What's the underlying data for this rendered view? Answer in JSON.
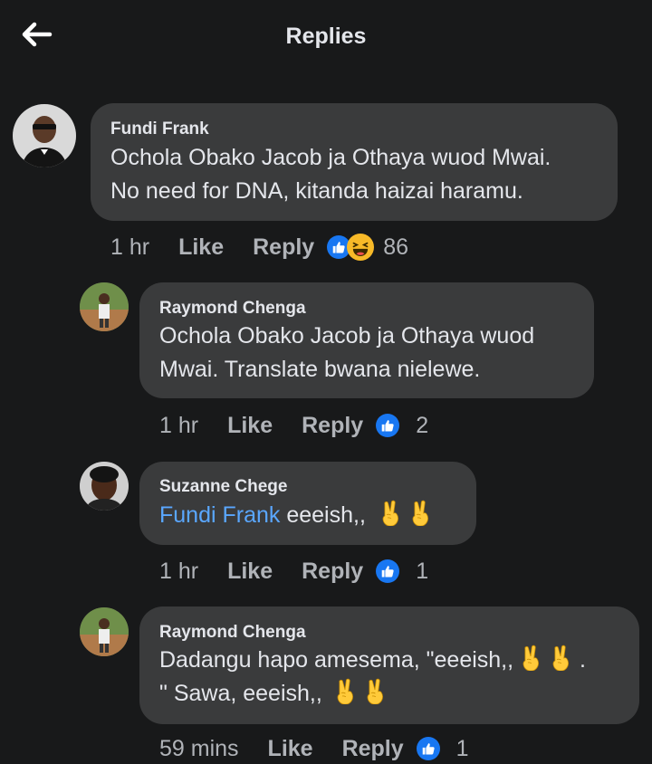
{
  "header": {
    "title": "Replies"
  },
  "comments": [
    {
      "author": "Fundi Frank",
      "lines": [
        "Ochola Obako Jacob ja Othaya wuod Mwai.",
        "No need for DNA, kitanda haizai haramu."
      ],
      "time": "1 hr",
      "like": "Like",
      "reply": "Reply",
      "reactions": [
        "like",
        "haha"
      ],
      "count": "86"
    },
    {
      "author": "Raymond Chenga",
      "lines": [
        "Ochola Obako Jacob ja Othaya wuod",
        "Mwai. Translate bwana nielewe."
      ],
      "time": "1 hr",
      "like": "Like",
      "reply": "Reply",
      "reactions": [
        "like"
      ],
      "count": "2"
    },
    {
      "author": "Suzanne Chege",
      "mention": "Fundi Frank",
      "text": " eeeish,,",
      "time": "1 hr",
      "like": "Like",
      "reply": "Reply",
      "reactions": [
        "like"
      ],
      "count": "1"
    },
    {
      "author": "Raymond Chenga",
      "line1": "Dadangu hapo amesema, \"eeeish,,",
      "line1_end": ".",
      "line2": "\" Sawa, eeeish,,",
      "time": "59 mins",
      "like": "Like",
      "reply": "Reply",
      "reactions": [
        "like"
      ],
      "count": "1"
    }
  ],
  "colors": {
    "background": "#18191a",
    "bubble": "#3a3b3c",
    "mention": "#5aa7ff",
    "like_blue": "#1877f2"
  },
  "icons": {
    "back": "arrow-left-icon",
    "like": "thumbs-up-icon",
    "haha": "laughing-emoji-icon",
    "victory": "victory-hand-emoji-icon"
  }
}
